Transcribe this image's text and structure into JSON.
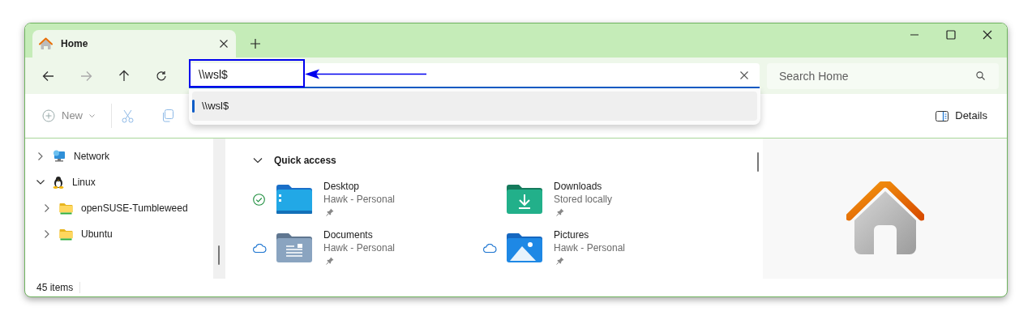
{
  "tabs": [
    {
      "title": "Home",
      "selected": true
    }
  ],
  "address": {
    "value": "\\\\wsl$",
    "focused": true
  },
  "suggestions": [
    {
      "text": "\\\\wsl$",
      "selected": true
    }
  ],
  "search": {
    "placeholder": "Search Home"
  },
  "toolbar": {
    "new_label": "New",
    "details_label": "Details"
  },
  "sidebar": {
    "items": [
      {
        "label": "Network",
        "kind": "network",
        "expanded": false
      },
      {
        "label": "Linux",
        "kind": "linux",
        "expanded": true,
        "children": [
          {
            "label": "openSUSE-Tumbleweed",
            "kind": "drive",
            "expanded": false
          },
          {
            "label": "Ubuntu",
            "kind": "drive",
            "expanded": false
          }
        ]
      }
    ]
  },
  "quick_access": {
    "title": "Quick access",
    "expanded": true,
    "items": [
      {
        "name": "Desktop",
        "subtitle": "Hawk - Personal",
        "kind": "desktop",
        "synced": true,
        "cloud": false,
        "pinned": true
      },
      {
        "name": "Downloads",
        "subtitle": "Stored locally",
        "kind": "downloads",
        "synced": false,
        "cloud": false,
        "pinned": true
      },
      {
        "name": "Documents",
        "subtitle": "Hawk - Personal",
        "kind": "documents",
        "synced": false,
        "cloud": true,
        "pinned": true
      },
      {
        "name": "Pictures",
        "subtitle": "Hawk - Personal",
        "kind": "pictures",
        "synced": false,
        "cloud": true,
        "pinned": true
      }
    ]
  },
  "status_bar": {
    "text": "45 items"
  }
}
